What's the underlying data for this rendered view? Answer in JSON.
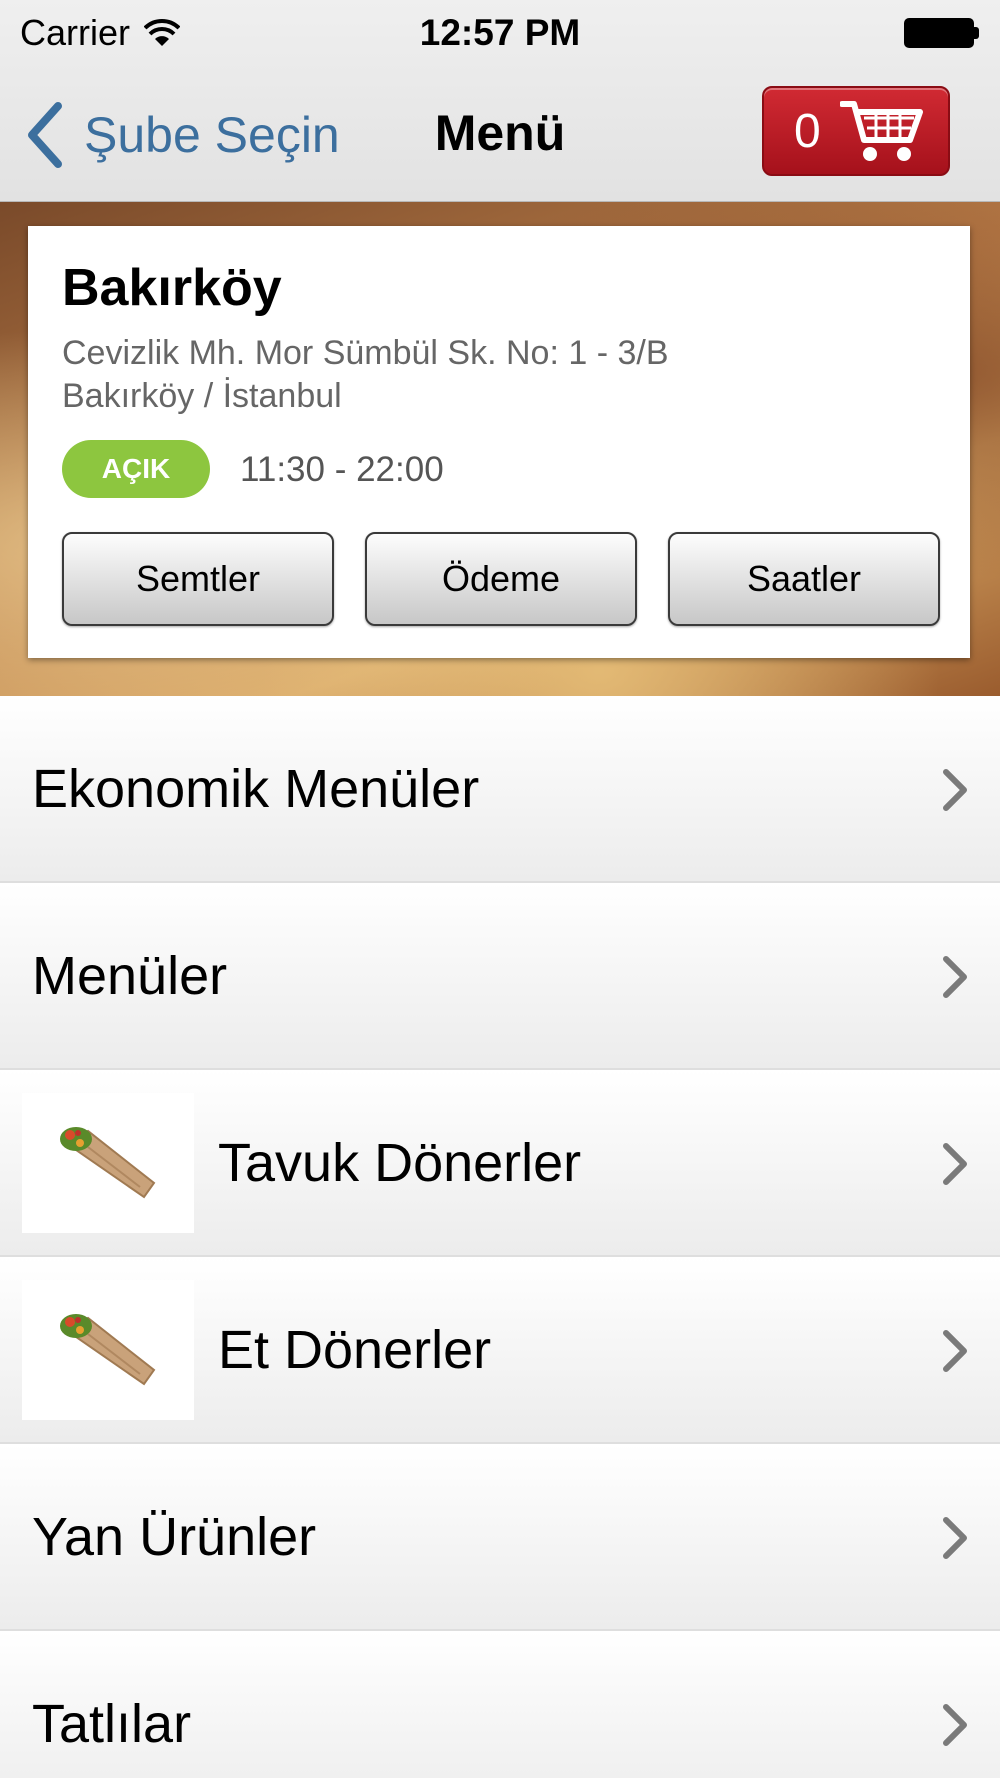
{
  "status_bar": {
    "carrier": "Carrier",
    "time": "12:57 PM"
  },
  "nav": {
    "back_label": "Şube Seçin",
    "title": "Menü",
    "cart_count": "0"
  },
  "branch": {
    "name": "Bakırköy",
    "address_line1": "Cevizlik Mh. Mor Sümbül Sk. No: 1 - 3/B",
    "address_line2": "Bakırköy / İstanbul",
    "status_badge": "AÇIK",
    "hours": "11:30 - 22:00",
    "buttons": [
      "Semtler",
      "Ödeme",
      "Saatler"
    ]
  },
  "menu": {
    "items": [
      {
        "label": "Ekonomik Menüler"
      },
      {
        "label": "Menüler"
      },
      {
        "label": "Tavuk Dönerler",
        "icon": "wrap-icon"
      },
      {
        "label": "Et Dönerler",
        "icon": "wrap-icon"
      },
      {
        "label": "Yan Ürünler"
      },
      {
        "label": "Tatlılar"
      }
    ]
  },
  "colors": {
    "accent": "#3c6f9e",
    "cart": "#c41e2a",
    "open_badge": "#8dc63f"
  }
}
